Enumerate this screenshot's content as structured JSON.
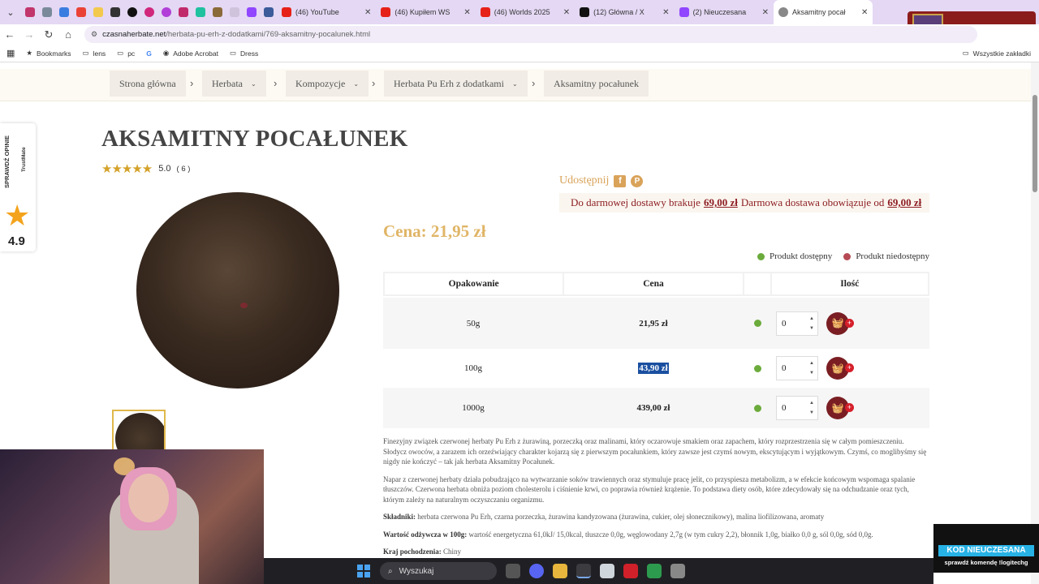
{
  "tabs": [
    {
      "label": "(46) YouTube",
      "color": "#e62117"
    },
    {
      "label": "(46) Kupiłem WS",
      "color": "#e62117"
    },
    {
      "label": "(46) Worlds 2025",
      "color": "#e62117"
    },
    {
      "label": "(12) Główna / X",
      "color": "#111111"
    },
    {
      "label": "(2) Nieuczesana",
      "color": "#9146ff"
    },
    {
      "label": "Aksamitny pocał",
      "color": "#888888"
    }
  ],
  "address": {
    "domain": "czasnaherbate.net",
    "path": "/herbata-pu-erh-z-dodatkami/769-aksamitny-pocalunek.html"
  },
  "bookmarks": [
    "Bookmarks",
    "lens",
    "pc",
    "Adobe Acrobat",
    "Dress"
  ],
  "bookmarks_all": "Wszystkie zakładki",
  "ext_badge": "SP",
  "breadcrumb": [
    {
      "label": "Strona główna"
    },
    {
      "label": "Herbata"
    },
    {
      "label": "Kompozycje"
    },
    {
      "label": "Herbata Pu Erh z dodatkami"
    },
    {
      "label": "Aksamitny pocałunek"
    }
  ],
  "trustmate": {
    "label": "SPRAWDŹ OPINIE",
    "brand": "TrustMate",
    "score": "4.9"
  },
  "product": {
    "title": "AKSAMITNY POCAŁUNEK",
    "rating": "5.0",
    "rating_count": "( 6 )",
    "share_label": "Udostępnij",
    "shipping_text": "Do darmowej dostawy brakuje",
    "shipping_missing": "69,00 zł",
    "shipping_text2": "Darmowa dostawa obowiązuje od",
    "shipping_threshold": "69,00 zł",
    "price": "Cena: 21,95 zł",
    "legend_available": "Produkt dostępny",
    "legend_unavailable": "Produkt niedostępny"
  },
  "table": {
    "headers": [
      "Opakowanie",
      "Cena",
      "",
      "Ilość"
    ],
    "rows": [
      {
        "size": "50g",
        "price": "21,95 zł",
        "qty": "0"
      },
      {
        "size": "100g",
        "price": "43,90 zł",
        "qty": "0"
      },
      {
        "size": "1000g",
        "price": "439,00 zł",
        "qty": "0"
      }
    ]
  },
  "description": {
    "p1": "Finezyjny związek czerwonej herbaty Pu Erh z żurawiną, porzeczką oraz malinami, który oczarowuje smakiem oraz zapachem, który rozprzestrzenia się w całym pomieszczeniu. Słodycz owoców, a zarazem ich orzeźwiający charakter kojarzą się z pierwszym pocałunkiem, który zawsze jest czymś nowym, ekscytującym i wyjątkowym. Czymś, co moglibyśmy się nigdy nie kończyć – tak jak herbata Aksamitny Pocałunek.",
    "p2": "Napar z czerwonej herbaty działa pobudzająco na wytwarzanie soków trawiennych oraz stymuluje pracę jelit, co przyspiesza metabolizm, a w efekcie końcowym wspomaga spalanie tłuszczów. Czerwona herbata obniża poziom cholesterolu i ciśnienie krwi, co poprawia również krążenie. To podstawa diety osób, które zdecydowały się na odchudzanie oraz tych, którym zależy na naturalnym oczyszczaniu organizmu.",
    "ing_label": "Składniki:",
    "ing": "herbata czerwona Pu Erh, czarna porzeczka, żurawina kandyzowana (żurawina, cukier, olej słonecznikowy), malina liofilizowana, aromaty",
    "nut_label": "Wartość odżywcza w 100g:",
    "nut": "wartość energetyczna 61,0kJ/ 15,0kcal, tłuszcze 0,0g, węglowodany 2,7g (w tym cukry 2,2), błonnik 1,0g, białko 0,0 g, sól 0,0g, sód 0,0g.",
    "origin_label": "Kraj pochodzenia:",
    "origin": "Chiny"
  },
  "taskbar": {
    "search": "Wyszukaj"
  },
  "overlay": {
    "kod": "KOD NIEUCZESANA",
    "sub": "sprawdź komendę !logitechg"
  }
}
